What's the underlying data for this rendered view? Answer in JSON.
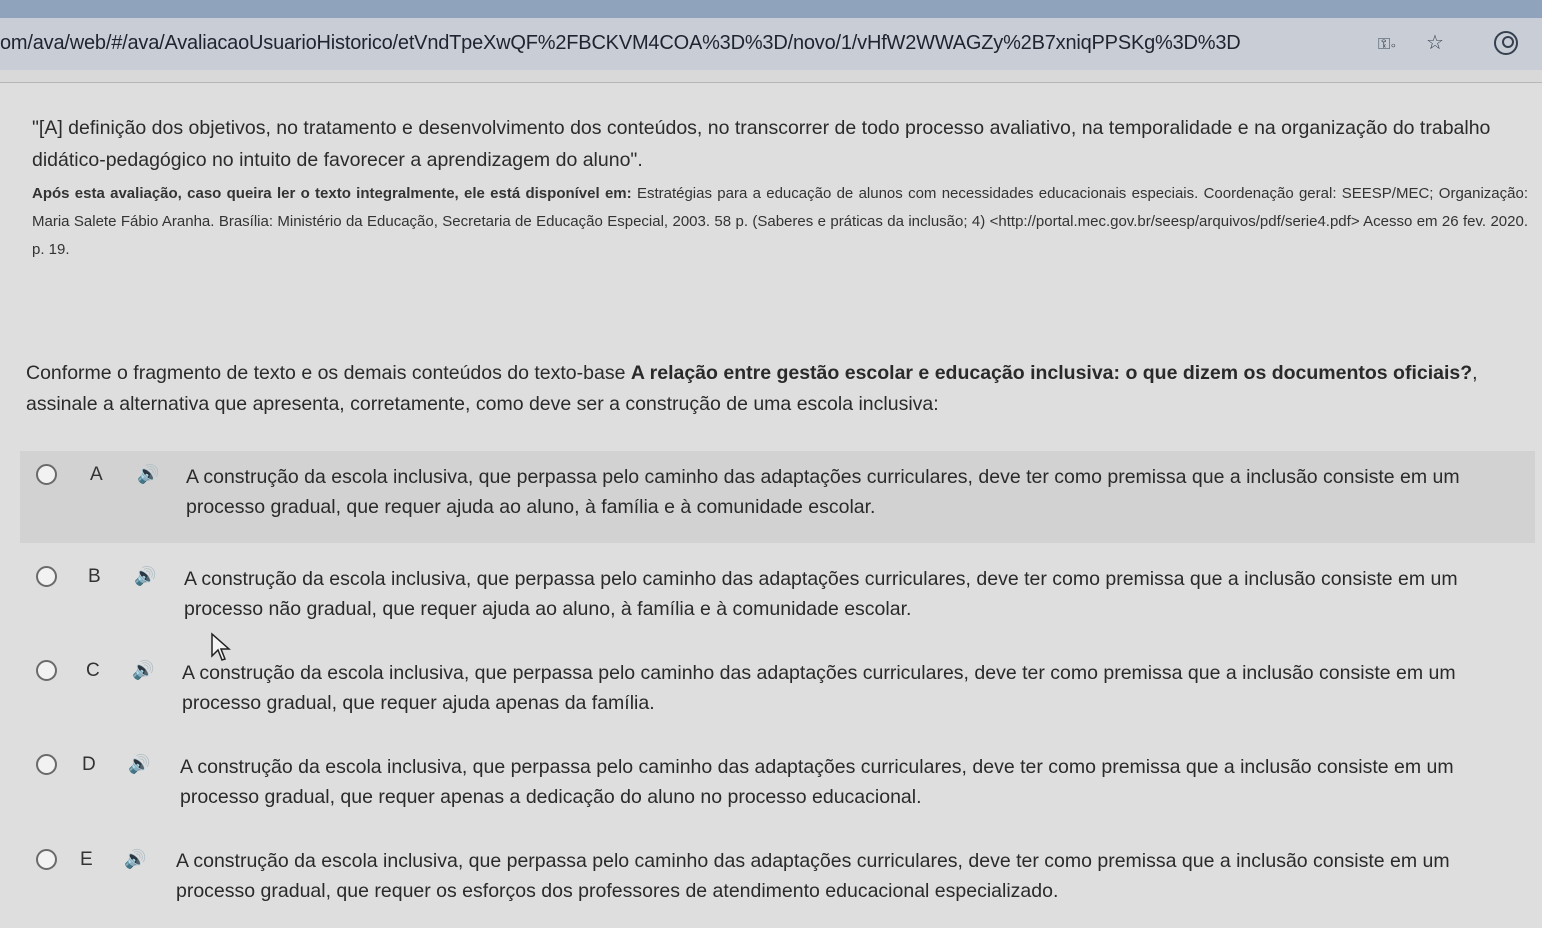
{
  "browser": {
    "url": "om/ava/web/#/ava/AvaliacaoUsuarioHistorico/etVndTpeXwQF%2FBCKVM4COA%3D%3D/novo/1/vHfW2WWAGZy%2B7xniqPPSKg%3D%3D",
    "icons": [
      "key-icon",
      "star-icon",
      "profile-icon"
    ]
  },
  "quote": {
    "text": "\"[A] definição dos objetivos, no tratamento e desenvolvimento dos conteúdos, no transcorrer de todo processo avaliativo, na temporalidade e na organização do trabalho didático-pedagógico no intuito de favorecer a aprendizagem do aluno\"."
  },
  "citation": {
    "lead": "Após esta avaliação, caso queira ler o texto integralmente, ele está disponível em:",
    "rest": " Estratégias para a educação de alunos com necessidades educacionais especiais. Coordenação geral: SEESP/MEC; Organização: Maria Salete Fábio Aranha. Brasília: Ministério da Educação, Secretaria de Educação Especial, 2003. 58 p. (Saberes e práticas da inclusão; 4) <http://portal.mec.gov.br/seesp/arquivos/pdf/serie4.pdf> Acesso em 26 fev. 2020. p. 19."
  },
  "question": {
    "intro": "Conforme o fragmento de texto e os demais conteúdos do texto-base ",
    "bold": "A relação entre gestão escolar e educação inclusiva: o que dizem os documentos oficiais?",
    "outro": ", assinale a alternativa que apresenta, corretamente, como deve ser a construção de uma escola inclusiva:"
  },
  "options": [
    {
      "letter": "A",
      "text": "A construção da escola inclusiva, que perpassa pelo caminho das adaptações curriculares, deve ter como premissa que a inclusão consiste em um processo gradual, que requer ajuda ao aluno, à família e à comunidade escolar."
    },
    {
      "letter": "B",
      "text": "A construção da escola inclusiva, que perpassa pelo caminho das adaptações curriculares, deve ter como premissa que a inclusão consiste em um processo não gradual, que requer ajuda ao aluno, à família e à comunidade escolar."
    },
    {
      "letter": "C",
      "text": "A construção da escola inclusiva, que perpassa pelo caminho das adaptações curriculares, deve ter como premissa que a inclusão consiste em um processo gradual, que requer ajuda apenas da família."
    },
    {
      "letter": "D",
      "text": "A construção da escola inclusiva, que perpassa pelo caminho das adaptações curriculares, deve ter como premissa que a inclusão consiste em um processo gradual, que requer apenas a dedicação do aluno no processo educacional."
    },
    {
      "letter": "E",
      "text": "A construção da escola inclusiva, que perpassa pelo caminho das adaptações curriculares, deve ter como premissa que a inclusão consiste em um processo gradual, que requer os esforços dos professores de atendimento educacional especializado."
    }
  ]
}
